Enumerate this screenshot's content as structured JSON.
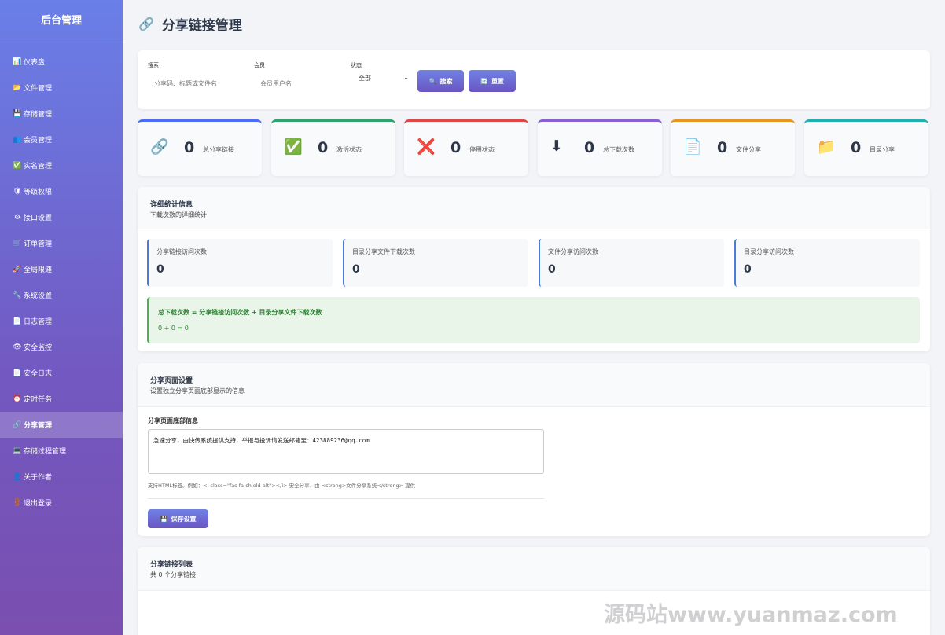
{
  "sidebar": {
    "brand": "后台管理",
    "items": [
      {
        "icon": "📊",
        "label": "仪表盘"
      },
      {
        "icon": "📂",
        "label": "文件管理"
      },
      {
        "icon": "💾",
        "label": "存储管理"
      },
      {
        "icon": "👥",
        "label": "会员管理"
      },
      {
        "icon": "✅",
        "label": "实名管理"
      },
      {
        "icon": "🛡",
        "label": "等级权限"
      },
      {
        "icon": "⚙",
        "label": "接口设置"
      },
      {
        "icon": "🛒",
        "label": "订单管理"
      },
      {
        "icon": "🚀",
        "label": "全局限速"
      },
      {
        "icon": "🔧",
        "label": "系统设置"
      },
      {
        "icon": "📄",
        "label": "日志管理"
      },
      {
        "icon": "👁",
        "label": "安全监控"
      },
      {
        "icon": "📄",
        "label": "安全日志"
      },
      {
        "icon": "⏰",
        "label": "定时任务"
      },
      {
        "icon": "🔗",
        "label": "分享管理"
      },
      {
        "icon": "💻",
        "label": "存储过程管理"
      },
      {
        "icon": "👤",
        "label": "关于作者"
      },
      {
        "icon": "🚪",
        "label": "退出登录"
      }
    ],
    "active_index": 14
  },
  "page": {
    "title": "分享链接管理",
    "title_icon": "🔗"
  },
  "search": {
    "keyword_label": "搜索",
    "keyword_placeholder": "分享码、标题或文件名",
    "member_label": "会员",
    "member_placeholder": "会员用户名",
    "status_label": "状态",
    "status_value": "全部",
    "search_button": "搜索",
    "reset_button": "重置"
  },
  "stats": [
    {
      "icon": "🔗",
      "value": "0",
      "label": "总分享链接",
      "color": "#4a6cf7"
    },
    {
      "icon": "✅",
      "value": "0",
      "label": "激活状态",
      "color": "#2ea36b"
    },
    {
      "icon": "❌",
      "value": "0",
      "label": "停用状态",
      "color": "#e04646"
    },
    {
      "icon": "⬇",
      "value": "0",
      "label": "总下载次数",
      "color": "#8a5fd6"
    },
    {
      "icon": "📄",
      "value": "0",
      "label": "文件分享",
      "color": "#e6961f"
    },
    {
      "icon": "📁",
      "value": "0",
      "label": "目录分享",
      "color": "#1fb0b0"
    }
  ],
  "detail": {
    "title": "详细统计信息",
    "subtitle": "下载次数的详细统计",
    "items": [
      {
        "label": "分享链接访问次数",
        "value": "0"
      },
      {
        "label": "目录分享文件下载次数",
        "value": "0"
      },
      {
        "label": "文件分享访问次数",
        "value": "0"
      },
      {
        "label": "目录分享访问次数",
        "value": "0"
      }
    ],
    "formula_title": "总下载次数 = 分享链接访问次数 + 目录分享文件下载次数",
    "formula_value": "0 + 0 = 0"
  },
  "settings": {
    "title": "分享页面设置",
    "subtitle": "设置独立分享页面底部显示的信息",
    "field_label": "分享页面底部信息",
    "field_value": "急速分享，由快传系统提供支持，举报与投诉请发送邮箱至：423889236@qq.com",
    "hint": "支持HTML标签。例如：<i class=\"fas fa-shield-alt\"></i> 安全分享，由 <strong>文件分享系统</strong> 提供",
    "save_button": "保存设置"
  },
  "list": {
    "title": "分享链接列表",
    "subtitle": "共 0 个分享链接"
  },
  "watermark": "源码站www.yuanmaz.com"
}
